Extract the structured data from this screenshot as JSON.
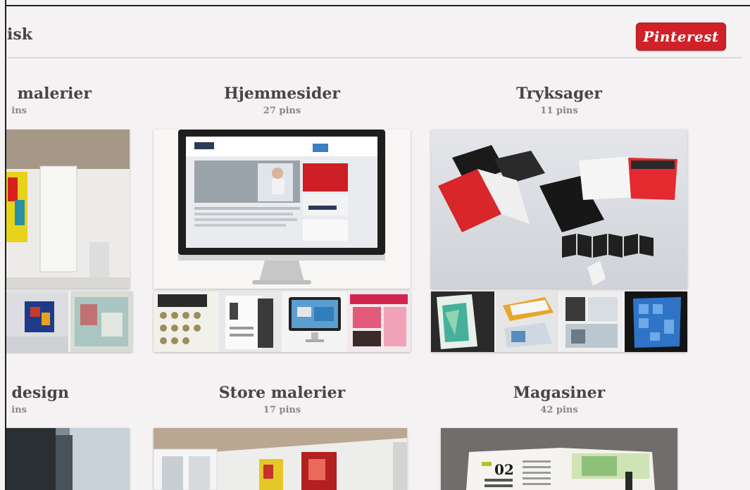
{
  "header": {
    "title": "isk",
    "pinterest_label": "Pinterest"
  },
  "boards": [
    {
      "title": "malerier",
      "count": "ins"
    },
    {
      "title": "Hjemmesider",
      "count": "27 pins"
    },
    {
      "title": "Tryksager",
      "count": "11 pins"
    },
    {
      "title": "design",
      "count": "ins"
    },
    {
      "title": "Store malerier",
      "count": "17 pins"
    },
    {
      "title": "Magasiner",
      "count": "42 pins"
    }
  ],
  "magazine": {
    "number": "02"
  },
  "colors": {
    "brand_red": "#cf2127",
    "background": "#f4f2f2"
  }
}
